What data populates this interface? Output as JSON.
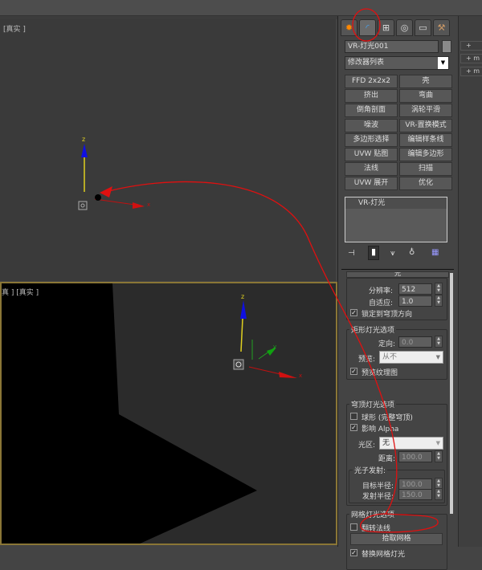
{
  "viewports": {
    "top_label": "[真实 ]",
    "bottom_label": "真 ] [真实 ]",
    "axis_z": "z",
    "axis_x": "x",
    "axis_y": "y"
  },
  "command_panel": {
    "tabs": [
      {
        "icon": "create-icon"
      },
      {
        "icon": "modify-icon",
        "active": true
      },
      {
        "icon": "hierarchy-icon"
      },
      {
        "icon": "motion-icon"
      },
      {
        "icon": "display-icon"
      },
      {
        "icon": "utilities-icon"
      }
    ],
    "object_name": "VR-灯光001",
    "object_color": "#8a8a8a",
    "modifier_list": "修改器列表",
    "modifier_buttons": [
      "FFD 2x2x2",
      "壳",
      "挤出",
      "弯曲",
      "倒角剖面",
      "涡轮平滑",
      "噪波",
      "VR-置换模式",
      "多边形选择",
      "编辑样条线",
      "UVW 贴图",
      "编辑多边形",
      "法线",
      "扫描",
      "UVW 展开",
      "优化"
    ],
    "stack": [
      "VR-灯光"
    ],
    "rollout_top": "光",
    "subdivs": {
      "label": "分辨率:",
      "value": "512"
    },
    "adaptive": {
      "label": "自适应:",
      "value": "1.0"
    },
    "lock_dome": {
      "label": "锁定到穹顶方向",
      "checked": true
    },
    "rect_group": {
      "title": "矩形灯光选项",
      "directional_label": "定向:",
      "directional_value": "0.0",
      "preview_label": "预览:",
      "preview_value": "从不",
      "preview_texture": {
        "label": "预览纹理图",
        "checked": true
      }
    },
    "dome_group": {
      "title": "穹顶灯光选项",
      "spherical": {
        "label": "球形 (完整穹顶)",
        "checked": false
      },
      "affect_alpha": {
        "label": "影响 Alpha",
        "checked": true
      },
      "zone_label": "光区:",
      "zone_value": "无",
      "distance_label": "距离:",
      "distance_value": "100.0",
      "photon": {
        "title": "光子发射:",
        "target_label": "目标半径:",
        "target_value": "100.0",
        "emit_label": "发射半径:",
        "emit_value": "150.0"
      }
    },
    "mesh_group": {
      "title": "网格灯光选项",
      "flip_normals": {
        "label": "翻转法线",
        "checked": false
      },
      "pick_mesh": "拾取网格",
      "replace_mesh": {
        "label": "替换网格灯光",
        "checked": true
      }
    }
  },
  "right_panel": {
    "items": [
      "",
      "m",
      "m"
    ]
  },
  "annotation_color": "#e01010"
}
